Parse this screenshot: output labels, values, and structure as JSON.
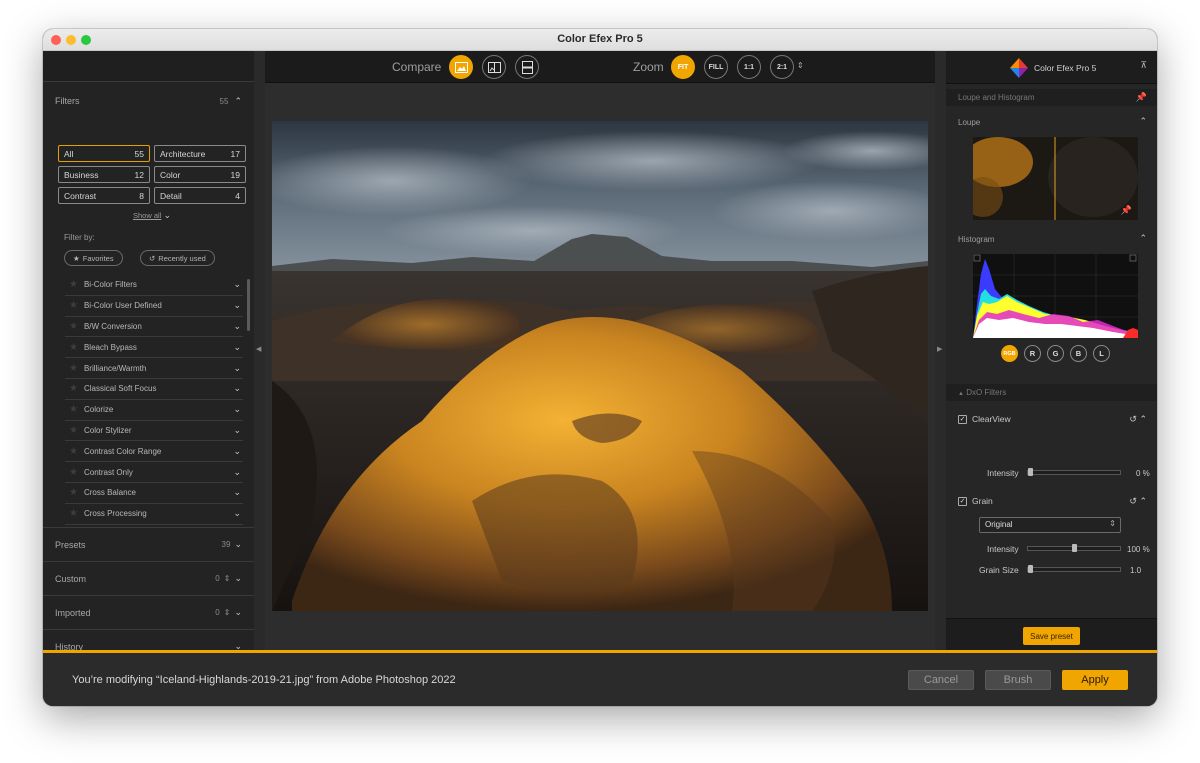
{
  "window": {
    "title": "Color Efex Pro 5"
  },
  "left_panel": {
    "filters": {
      "label": "Filters",
      "count": "55"
    },
    "categories": [
      {
        "label": "All",
        "count": "55"
      },
      {
        "label": "Architecture",
        "count": "17"
      },
      {
        "label": "Business",
        "count": "12"
      },
      {
        "label": "Color",
        "count": "19"
      },
      {
        "label": "Contrast",
        "count": "8"
      },
      {
        "label": "Detail",
        "count": "4"
      }
    ],
    "show_all": "Show all",
    "filter_by": "Filter by:",
    "favorites": "Favorites",
    "recently_used": "Recently used",
    "filter_list": [
      "Bi-Color Filters",
      "Bi-Color User Defined",
      "B/W Conversion",
      "Bleach Bypass",
      "Brilliance/Warmth",
      "Classical Soft Focus",
      "Colorize",
      "Color Stylizer",
      "Contrast Color Range",
      "Contrast Only",
      "Cross Balance",
      "Cross Processing"
    ],
    "sections": [
      {
        "label": "Presets",
        "count": "39"
      },
      {
        "label": "Custom",
        "count": "0"
      },
      {
        "label": "Imported",
        "count": "0"
      },
      {
        "label": "History",
        "count": ""
      }
    ]
  },
  "toolbar": {
    "compare_label": "Compare",
    "zoom_label": "Zoom",
    "zoom_options": [
      "FIT",
      "FILL",
      "1:1",
      "2:1"
    ]
  },
  "right_panel": {
    "app_name": "Color Efex Pro 5",
    "loupe_histogram_band": "Loupe and Histogram",
    "loupe_label": "Loupe",
    "histogram_label": "Histogram",
    "channels": [
      "RGB",
      "R",
      "G",
      "B",
      "L"
    ],
    "dxo_filters_band": "DxO Filters",
    "clearview": {
      "label": "ClearView",
      "intensity_label": "Intensity",
      "intensity_value": "0 %",
      "intensity_level": 0
    },
    "grain": {
      "label": "Grain",
      "mode": "Original",
      "intensity_label": "Intensity",
      "intensity_value": "100 %",
      "intensity_level": 0.5,
      "size_label": "Grain Size",
      "size_value": "1.0",
      "size_level": 0
    },
    "save_preset": "Save preset"
  },
  "footer": {
    "message": "You’re modifying “Iceland-Highlands-2019-21.jpg” from Adobe Photoshop 2022",
    "cancel": "Cancel",
    "brush": "Brush",
    "apply": "Apply"
  },
  "colors": {
    "accent": "#f0a500",
    "panel": "#232323",
    "canvas": "#2d2d2d"
  }
}
